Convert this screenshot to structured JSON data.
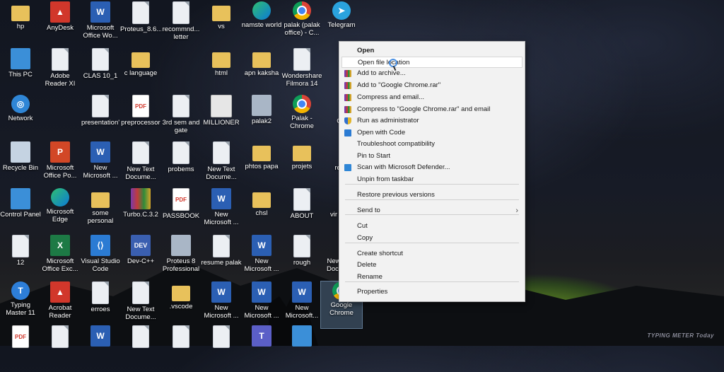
{
  "desktop": {
    "icons": [
      {
        "label": "hp",
        "glyph": "folder"
      },
      {
        "label": "AnyDesk",
        "glyph": "red"
      },
      {
        "label": "Microsoft Office Wo...",
        "glyph": "word"
      },
      {
        "label": "Proteus_8.6...",
        "glyph": "doc"
      },
      {
        "label": "recommnd... letter",
        "glyph": "doc"
      },
      {
        "label": "vs",
        "glyph": "folder"
      },
      {
        "label": "namste world",
        "glyph": "edge"
      },
      {
        "label": "palak (palak office) - C...",
        "glyph": "chrome"
      },
      {
        "label": "Telegram",
        "glyph": "tele"
      },
      {
        "label": "This PC",
        "glyph": "pc"
      },
      {
        "label": "Adobe Reader XI",
        "glyph": "doc"
      },
      {
        "label": "CLAS 10_1",
        "glyph": "doc"
      },
      {
        "label": "c language",
        "glyph": "folder"
      },
      {
        "label": "html",
        "glyph": "folder"
      },
      {
        "label": "apn kaksha",
        "glyph": "folder"
      },
      {
        "label": "Wondershare Filmora 14",
        "glyph": "doc"
      },
      {
        "label": "Network",
        "glyph": "net"
      },
      {
        "label": "presentation'",
        "glyph": "doc"
      },
      {
        "label": "preprocessor",
        "glyph": "pdf"
      },
      {
        "label": "3rd sem and gate",
        "glyph": "doc"
      },
      {
        "label": "MILLIONER",
        "glyph": "million"
      },
      {
        "label": "palak2",
        "glyph": "photo"
      },
      {
        "label": "Palak - Chrome",
        "glyph": "chrome"
      },
      {
        "label": "Recycle Bin",
        "glyph": "recycle"
      },
      {
        "label": "Microsoft Office Po...",
        "glyph": "ppt"
      },
      {
        "label": "New Microsoft ...",
        "glyph": "word"
      },
      {
        "label": "New Text Docume...",
        "glyph": "doc"
      },
      {
        "label": "probems",
        "glyph": "doc"
      },
      {
        "label": "New Text Docume...",
        "glyph": "doc"
      },
      {
        "label": "phtos papa",
        "glyph": "folder"
      },
      {
        "label": "projets",
        "glyph": "folder"
      },
      {
        "label": "Control Panel",
        "glyph": "pc"
      },
      {
        "label": "Microsoft Edge",
        "glyph": "edge"
      },
      {
        "label": "some personal",
        "glyph": "folder"
      },
      {
        "label": "Turbo.C.3.2",
        "glyph": "rar"
      },
      {
        "label": "PASSBOOK",
        "glyph": "pdf"
      },
      {
        "label": "New Microsoft ...",
        "glyph": "word"
      },
      {
        "label": "chsl",
        "glyph": "folder"
      },
      {
        "label": "ABOUT",
        "glyph": "doc"
      },
      {
        "label": "12",
        "glyph": "doc"
      },
      {
        "label": "Microsoft Office Exc...",
        "glyph": "excel"
      },
      {
        "label": "Visual Studio Code",
        "glyph": "vs"
      },
      {
        "label": "Dev-C++",
        "glyph": "dev"
      },
      {
        "label": "Proteus 8 Professional",
        "glyph": "photo"
      },
      {
        "label": "resume palak",
        "glyph": "doc"
      },
      {
        "label": "New Microsoft ...",
        "glyph": "word"
      },
      {
        "label": "rough",
        "glyph": "doc"
      },
      {
        "label": "Typing Master 11",
        "glyph": "typing"
      },
      {
        "label": "Acrobat Reader",
        "glyph": "red"
      },
      {
        "label": "erroes",
        "glyph": "doc"
      },
      {
        "label": "New Text Docume...",
        "glyph": "doc"
      },
      {
        "label": ".vscode",
        "glyph": "folder"
      },
      {
        "label": "New Microsoft ...",
        "glyph": "word"
      },
      {
        "label": "New Microsoft ...",
        "glyph": "word"
      },
      {
        "label": "New Microsoft...",
        "glyph": "word"
      },
      {
        "label": "Google Chrome",
        "glyph": "chrome"
      },
      {
        "label": "",
        "glyph": "pdf"
      },
      {
        "label": "",
        "glyph": "doc"
      },
      {
        "label": "",
        "glyph": "word"
      },
      {
        "label": "",
        "glyph": "doc"
      },
      {
        "label": "",
        "glyph": "doc"
      },
      {
        "label": "",
        "glyph": "doc"
      },
      {
        "label": "",
        "glyph": "teams"
      },
      {
        "label": "",
        "glyph": "pc"
      }
    ],
    "partial_labels": [
      "G",
      "res",
      "vir",
      "New Docu..."
    ]
  },
  "context_menu": {
    "items": [
      {
        "label": "Open",
        "icon": "",
        "bold": true
      },
      {
        "label": "Open file location",
        "icon": "",
        "highlighted": true
      },
      {
        "label": "Add to archive...",
        "icon": "rar-icon"
      },
      {
        "label": "Add to \"Google Chrome.rar\"",
        "icon": "rar-icon"
      },
      {
        "label": "Compress and email...",
        "icon": "rar-icon"
      },
      {
        "label": "Compress to \"Google Chrome.rar\" and email",
        "icon": "rar-icon"
      },
      {
        "label": "Run as administrator",
        "icon": "shield-icon"
      },
      {
        "label": "Open with Code",
        "icon": "vscode-icon"
      },
      {
        "label": "Troubleshoot compatibility",
        "icon": ""
      },
      {
        "label": "Pin to Start",
        "icon": ""
      },
      {
        "label": "Scan with Microsoft Defender...",
        "icon": "defender-icon"
      },
      {
        "label": "Unpin from taskbar",
        "icon": ""
      },
      {
        "label": "Restore previous versions",
        "icon": ""
      },
      {
        "label": "Send to",
        "icon": "",
        "submenu": true
      },
      {
        "label": "Cut",
        "icon": ""
      },
      {
        "label": "Copy",
        "icon": ""
      },
      {
        "label": "Create shortcut",
        "icon": ""
      },
      {
        "label": "Delete",
        "icon": ""
      },
      {
        "label": "Rename",
        "icon": ""
      },
      {
        "label": "Properties",
        "icon": ""
      }
    ],
    "submenu_glyph": "›"
  },
  "watermark": "TYPING METER Today"
}
